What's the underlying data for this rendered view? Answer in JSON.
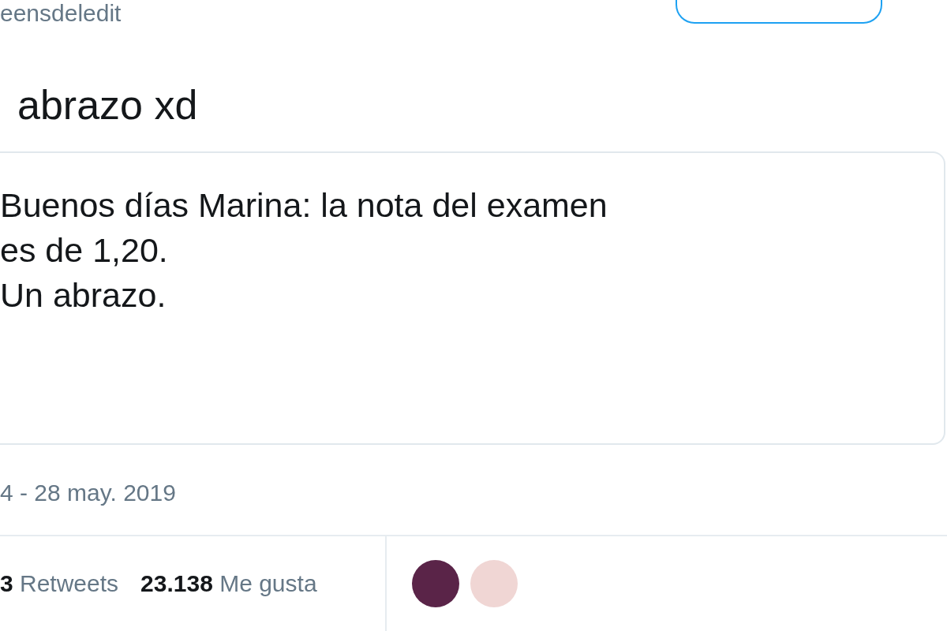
{
  "tweet": {
    "handle": "eensdeledit",
    "text": "abrazo xd",
    "quote": {
      "lines": [
        "Buenos días Marina: la nota del examen",
        "es de 1,20.",
        "Un abrazo."
      ]
    },
    "date": "4 - 28 may. 2019",
    "stats": [
      {
        "count": "3",
        "label": "Retweets"
      },
      {
        "count": "23.138",
        "label": "Me gusta"
      }
    ],
    "liker_avatars": [
      {
        "color": "#5a2448"
      },
      {
        "color": "#f0d6d4"
      }
    ]
  }
}
